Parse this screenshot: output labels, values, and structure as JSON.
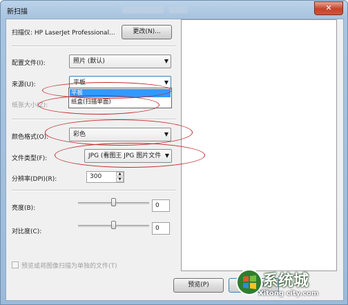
{
  "window": {
    "title": "新扫描",
    "close_glyph": "✕"
  },
  "scanner": {
    "label": "扫描仪: HP LaserJet Professional...",
    "change_button": "更改(N)..."
  },
  "profile": {
    "label": "配置文件(I):",
    "value": "照片 (默认)"
  },
  "source": {
    "label": "来源(U):",
    "value": "平板",
    "options": [
      "平板",
      "纸盒(扫描单面)"
    ],
    "highlighted_index": 0
  },
  "paper_size": {
    "label": "纸张大小(Z):"
  },
  "color_format": {
    "label": "颜色格式(O):",
    "value": "彩色"
  },
  "file_type": {
    "label": "文件类型(F):",
    "value": "JPG (看图王 JPG 图片文件"
  },
  "resolution": {
    "label": "分辨率(DPI)(R):",
    "value": "300"
  },
  "brightness": {
    "label": "亮度(B):",
    "value": "0",
    "level": 0.5
  },
  "contrast": {
    "label": "对比度(C):",
    "value": "0",
    "level": 0.5
  },
  "separate_files": {
    "label": "预览或将图像扫描为单独的文件(T)",
    "checked": false,
    "enabled": false
  },
  "buttons": {
    "preview": "预览(P)",
    "scan": "扫描(S)"
  },
  "watermark": {
    "text": "系统城",
    "url": "Xitong city.com"
  },
  "colors": {
    "annotation": "#c12a2a",
    "selection": "#3399ff",
    "title_bar": "#a9c4e0"
  }
}
